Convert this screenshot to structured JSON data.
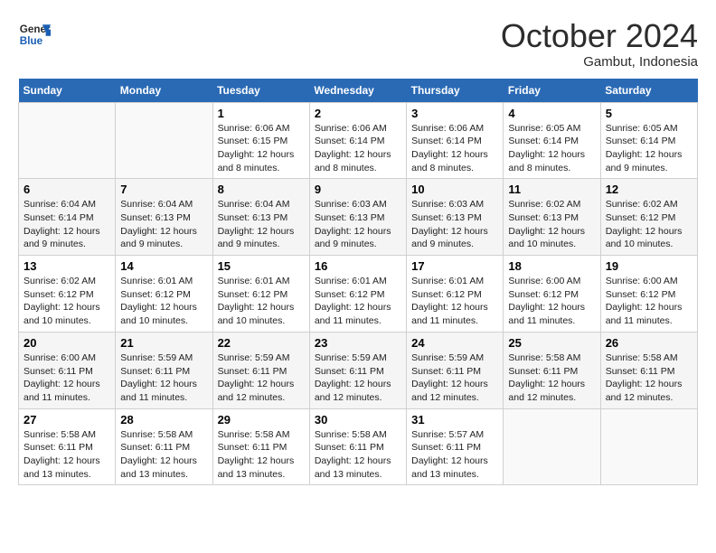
{
  "logo": {
    "line1": "General",
    "line2": "Blue"
  },
  "title": "October 2024",
  "location": "Gambut, Indonesia",
  "days_of_week": [
    "Sunday",
    "Monday",
    "Tuesday",
    "Wednesday",
    "Thursday",
    "Friday",
    "Saturday"
  ],
  "weeks": [
    [
      {
        "day": "",
        "info": ""
      },
      {
        "day": "",
        "info": ""
      },
      {
        "day": "1",
        "info": "Sunrise: 6:06 AM\nSunset: 6:15 PM\nDaylight: 12 hours and 8 minutes."
      },
      {
        "day": "2",
        "info": "Sunrise: 6:06 AM\nSunset: 6:14 PM\nDaylight: 12 hours and 8 minutes."
      },
      {
        "day": "3",
        "info": "Sunrise: 6:06 AM\nSunset: 6:14 PM\nDaylight: 12 hours and 8 minutes."
      },
      {
        "day": "4",
        "info": "Sunrise: 6:05 AM\nSunset: 6:14 PM\nDaylight: 12 hours and 8 minutes."
      },
      {
        "day": "5",
        "info": "Sunrise: 6:05 AM\nSunset: 6:14 PM\nDaylight: 12 hours and 9 minutes."
      }
    ],
    [
      {
        "day": "6",
        "info": "Sunrise: 6:04 AM\nSunset: 6:14 PM\nDaylight: 12 hours and 9 minutes."
      },
      {
        "day": "7",
        "info": "Sunrise: 6:04 AM\nSunset: 6:13 PM\nDaylight: 12 hours and 9 minutes."
      },
      {
        "day": "8",
        "info": "Sunrise: 6:04 AM\nSunset: 6:13 PM\nDaylight: 12 hours and 9 minutes."
      },
      {
        "day": "9",
        "info": "Sunrise: 6:03 AM\nSunset: 6:13 PM\nDaylight: 12 hours and 9 minutes."
      },
      {
        "day": "10",
        "info": "Sunrise: 6:03 AM\nSunset: 6:13 PM\nDaylight: 12 hours and 9 minutes."
      },
      {
        "day": "11",
        "info": "Sunrise: 6:02 AM\nSunset: 6:13 PM\nDaylight: 12 hours and 10 minutes."
      },
      {
        "day": "12",
        "info": "Sunrise: 6:02 AM\nSunset: 6:12 PM\nDaylight: 12 hours and 10 minutes."
      }
    ],
    [
      {
        "day": "13",
        "info": "Sunrise: 6:02 AM\nSunset: 6:12 PM\nDaylight: 12 hours and 10 minutes."
      },
      {
        "day": "14",
        "info": "Sunrise: 6:01 AM\nSunset: 6:12 PM\nDaylight: 12 hours and 10 minutes."
      },
      {
        "day": "15",
        "info": "Sunrise: 6:01 AM\nSunset: 6:12 PM\nDaylight: 12 hours and 10 minutes."
      },
      {
        "day": "16",
        "info": "Sunrise: 6:01 AM\nSunset: 6:12 PM\nDaylight: 12 hours and 11 minutes."
      },
      {
        "day": "17",
        "info": "Sunrise: 6:01 AM\nSunset: 6:12 PM\nDaylight: 12 hours and 11 minutes."
      },
      {
        "day": "18",
        "info": "Sunrise: 6:00 AM\nSunset: 6:12 PM\nDaylight: 12 hours and 11 minutes."
      },
      {
        "day": "19",
        "info": "Sunrise: 6:00 AM\nSunset: 6:12 PM\nDaylight: 12 hours and 11 minutes."
      }
    ],
    [
      {
        "day": "20",
        "info": "Sunrise: 6:00 AM\nSunset: 6:11 PM\nDaylight: 12 hours and 11 minutes."
      },
      {
        "day": "21",
        "info": "Sunrise: 5:59 AM\nSunset: 6:11 PM\nDaylight: 12 hours and 11 minutes."
      },
      {
        "day": "22",
        "info": "Sunrise: 5:59 AM\nSunset: 6:11 PM\nDaylight: 12 hours and 12 minutes."
      },
      {
        "day": "23",
        "info": "Sunrise: 5:59 AM\nSunset: 6:11 PM\nDaylight: 12 hours and 12 minutes."
      },
      {
        "day": "24",
        "info": "Sunrise: 5:59 AM\nSunset: 6:11 PM\nDaylight: 12 hours and 12 minutes."
      },
      {
        "day": "25",
        "info": "Sunrise: 5:58 AM\nSunset: 6:11 PM\nDaylight: 12 hours and 12 minutes."
      },
      {
        "day": "26",
        "info": "Sunrise: 5:58 AM\nSunset: 6:11 PM\nDaylight: 12 hours and 12 minutes."
      }
    ],
    [
      {
        "day": "27",
        "info": "Sunrise: 5:58 AM\nSunset: 6:11 PM\nDaylight: 12 hours and 13 minutes."
      },
      {
        "day": "28",
        "info": "Sunrise: 5:58 AM\nSunset: 6:11 PM\nDaylight: 12 hours and 13 minutes."
      },
      {
        "day": "29",
        "info": "Sunrise: 5:58 AM\nSunset: 6:11 PM\nDaylight: 12 hours and 13 minutes."
      },
      {
        "day": "30",
        "info": "Sunrise: 5:58 AM\nSunset: 6:11 PM\nDaylight: 12 hours and 13 minutes."
      },
      {
        "day": "31",
        "info": "Sunrise: 5:57 AM\nSunset: 6:11 PM\nDaylight: 12 hours and 13 minutes."
      },
      {
        "day": "",
        "info": ""
      },
      {
        "day": "",
        "info": ""
      }
    ]
  ]
}
